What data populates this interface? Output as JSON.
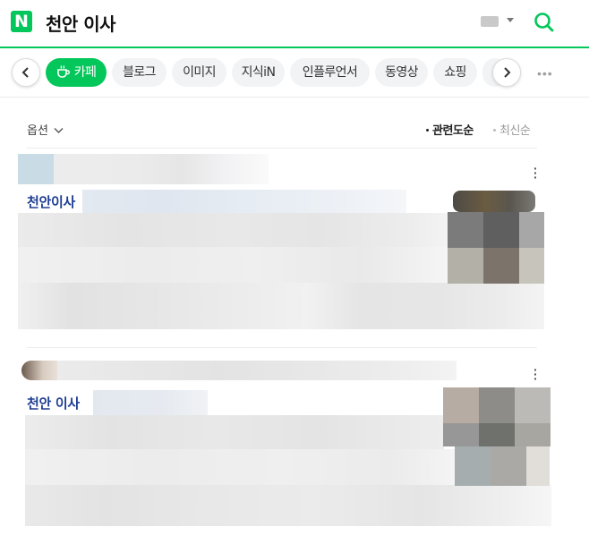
{
  "header": {
    "logo": "N",
    "query": "천안 이사",
    "icons": [
      "keyboard-icon",
      "search-icon"
    ],
    "brand_color": "#03c75a"
  },
  "tabs": {
    "items": [
      {
        "label": "카페",
        "active": true
      },
      {
        "label": "블로그",
        "active": false
      },
      {
        "label": "이미지",
        "active": false
      },
      {
        "label": "지식iN",
        "active": false
      },
      {
        "label": "인플루언서",
        "active": false
      },
      {
        "label": "동영상",
        "active": false
      },
      {
        "label": "쇼핑",
        "active": false
      }
    ]
  },
  "options": {
    "label": "옵션",
    "sort_relevance": "관련도순",
    "sort_recent": "최신순"
  },
  "results": [
    {
      "title": "천안이사"
    },
    {
      "title": "천안 이사"
    }
  ]
}
